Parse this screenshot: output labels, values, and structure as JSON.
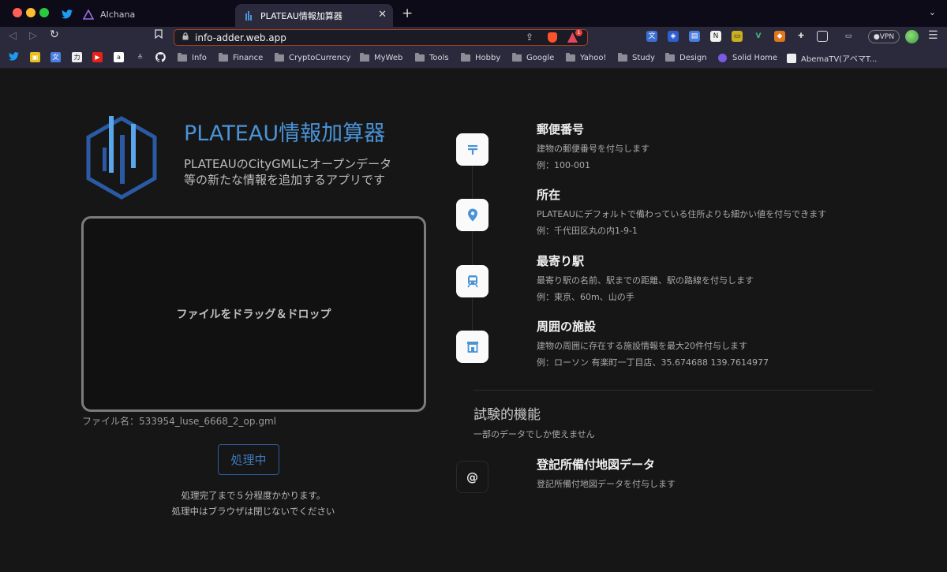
{
  "browser": {
    "tabs": [
      {
        "label": "",
        "icon": "twitter-icon"
      },
      {
        "label": "AIchana",
        "icon": "aichana-icon"
      },
      {
        "label": "PLATEAU情報加算器",
        "icon": "plateau-favicon",
        "active": true
      }
    ],
    "url": "info-adder.web.app",
    "rewards_badge": "1",
    "vpn_label": "VPN",
    "bookmarks": [
      {
        "label": "Info",
        "type": "folder"
      },
      {
        "label": "Finance",
        "type": "folder"
      },
      {
        "label": "CryptoCurrency",
        "type": "folder"
      },
      {
        "label": "MyWeb",
        "type": "folder"
      },
      {
        "label": "Tools",
        "type": "folder"
      },
      {
        "label": "Hobby",
        "type": "folder"
      },
      {
        "label": "Google",
        "type": "folder"
      },
      {
        "label": "Yahoo!",
        "type": "folder"
      },
      {
        "label": "Study",
        "type": "folder"
      },
      {
        "label": "Design",
        "type": "folder"
      },
      {
        "label": "Solid Home",
        "type": "link"
      },
      {
        "label": "AbemaTV(アベマT...",
        "type": "link"
      }
    ]
  },
  "app": {
    "title": "PLATEAU情報加算器",
    "subtitle_line1": "PLATEAUのCityGMLにオープンデータ",
    "subtitle_line2": "等の新たな情報を追加するアプリです",
    "accent_color": "#4a93d6",
    "dropzone_label": "ファイルをドラッグ＆ドロップ",
    "filename": "ファイル名：533954_luse_6668_2_op.gml",
    "process_button": "処理中",
    "process_note_line1": "処理完了まで５分程度かかります。",
    "process_note_line2": "処理中はブラウザは閉じないでください"
  },
  "features": [
    {
      "title": "郵便番号",
      "desc": "建物の郵便番号を付与します",
      "example": "例：100-001",
      "icon": "postal-mark-icon"
    },
    {
      "title": "所在",
      "desc": "PLATEAUにデフォルトで備わっている住所よりも細かい値を付与できます",
      "example": "例：千代田区丸の内1-9-1",
      "icon": "location-pin-icon"
    },
    {
      "title": "最寄り駅",
      "desc": "最寄り駅の名前、駅までの距離、駅の路線を付与します",
      "example": "例：東京、60m、山の手",
      "icon": "train-icon"
    },
    {
      "title": "周囲の施設",
      "desc": "建物の周囲に存在する施設情報を最大20件付与します",
      "example": "例：ローソン 有楽町一丁目店、35.674688 139.7614977",
      "icon": "store-icon"
    }
  ],
  "experimental": {
    "title": "試験的機能",
    "subtitle": "一部のデータでしか使えません",
    "items": [
      {
        "title": "登記所備付地図データ",
        "desc": "登記所備付地図データを付与します",
        "icon": "at-sign-icon"
      }
    ]
  }
}
